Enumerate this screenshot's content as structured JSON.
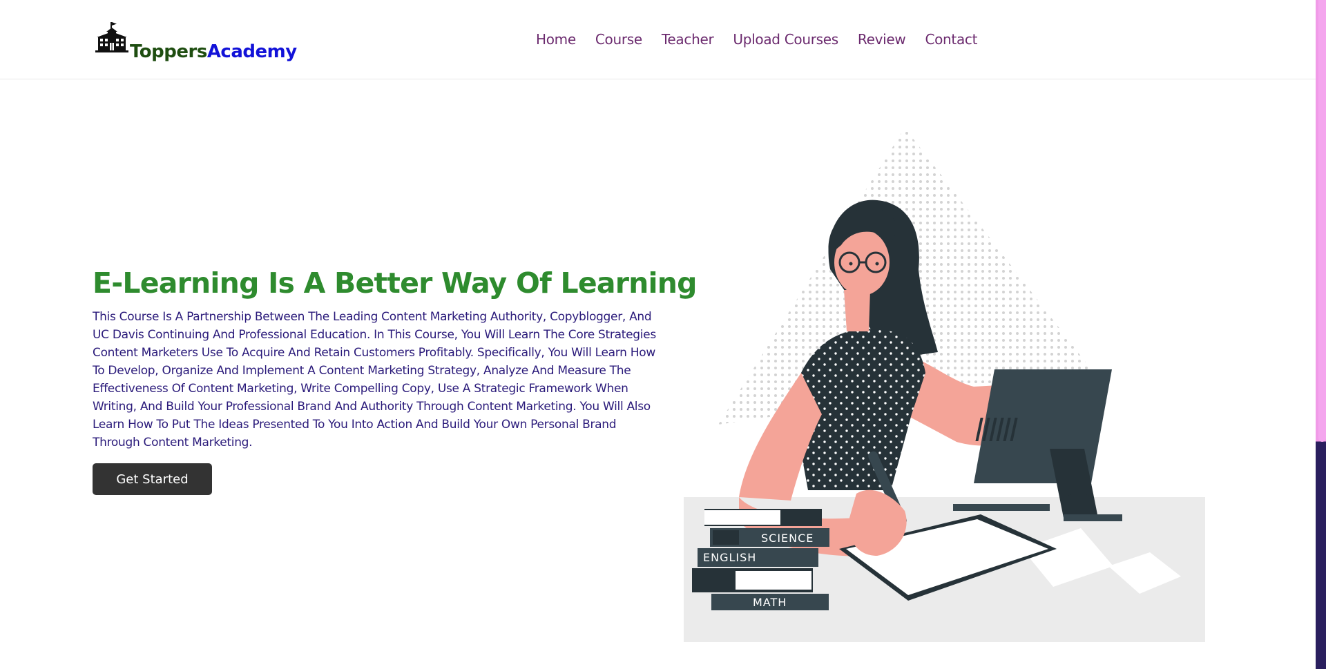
{
  "brand": {
    "name_part1": "Toppers",
    "name_part2": "Academy",
    "logo_icon": "school-building-icon",
    "colors": {
      "part1": "#1e4d10",
      "part2": "#1212d8"
    }
  },
  "nav": {
    "items": [
      {
        "label": "Home"
      },
      {
        "label": "Course"
      },
      {
        "label": "Teacher"
      },
      {
        "label": "Upload Courses"
      },
      {
        "label": "Review"
      },
      {
        "label": "Contact"
      }
    ],
    "color": "#6b2a6e"
  },
  "hero": {
    "title": "E-Learning Is A Better Way Of Learning",
    "description": "This Course Is A Partnership Between The Leading Content Marketing Authority, Copyblogger, And UC Davis Continuing And Professional Education. In This Course, You Will Learn The Core Strategies Content Marketers Use To Acquire And Retain Customers Profitably. Specifically, You Will Learn How To Develop, Organize And Implement A Content Marketing Strategy, Analyze And Measure The Effectiveness Of Content Marketing, Write Compelling Copy, Use A Strategic Framework When Writing, And Build Your Professional Brand And Authority Through Content Marketing. You Will Also Learn How To Put The Ideas Presented To You Into Action And Build Your Own Personal Brand Through Content Marketing.",
    "button_label": "Get Started",
    "title_color": "#2e8b2e",
    "text_color": "#2a1a7a"
  },
  "illustration": {
    "book_labels": {
      "science": "SCIENCE",
      "english": "ENGLISH",
      "math": "MATH"
    }
  },
  "scrollbar": {
    "thumb_color": "#f4a6ee"
  }
}
